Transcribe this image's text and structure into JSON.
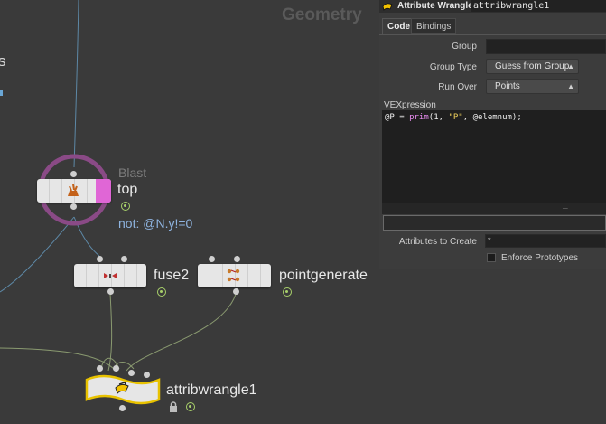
{
  "network": {
    "context_title": "Geometry",
    "edge_label": "s",
    "nodes": {
      "blast": {
        "type": "Blast",
        "name": "top",
        "comment": "not: @N.y!=0"
      },
      "fuse": {
        "name": "fuse2"
      },
      "pointgenerate": {
        "name": "pointgenerate"
      },
      "attribwrangle": {
        "name": "attribwrangle1"
      }
    }
  },
  "params": {
    "node_type": "Attribute Wrangle",
    "node_name": "attribwrangle1",
    "tabs": [
      "Code",
      "Bindings"
    ],
    "group_label": "Group",
    "group_value": "",
    "group_type_label": "Group Type",
    "group_type_value": "Guess from Group",
    "run_over_label": "Run Over",
    "run_over_value": "Points",
    "vex_label": "VEXpression",
    "code_parts": {
      "a": "@P = ",
      "fn": "prim",
      "b": "(1, ",
      "str": "\"P\"",
      "c": ", @elemnum);"
    },
    "attrs_label": "Attributes to Create",
    "attrs_value": "*",
    "enforce_label": "Enforce Prototypes"
  },
  "colors": {
    "accent_blue": "#8fb4e0",
    "status_green": "#a8d06a",
    "bypass_pink": "#e066d6",
    "selected_yellow": "#e8c200",
    "vex_function": "#e88cf0",
    "vex_string": "#f2d35c"
  },
  "icons": {
    "blast": "blast-icon",
    "fuse": "fuse-icon",
    "pointgenerate": "pointgenerate-icon",
    "attribwrangle": "wrangle-icon",
    "lock": "lock-icon",
    "header": "wrangle-icon"
  }
}
